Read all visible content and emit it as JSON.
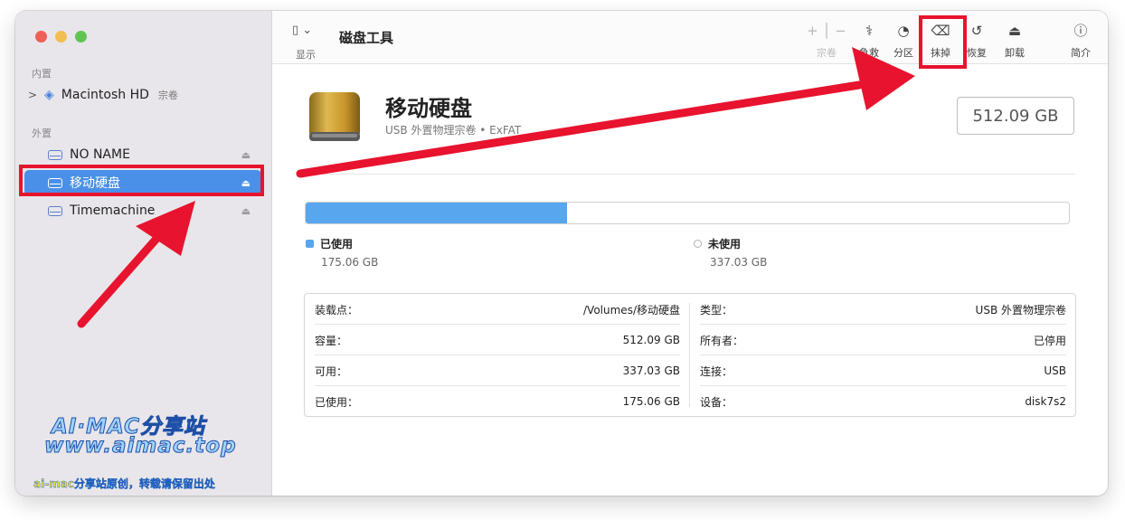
{
  "sidebar": {
    "section_internal": "内置",
    "internal_items": [
      {
        "label": "Macintosh HD",
        "sub": "宗卷"
      }
    ],
    "section_external": "外置",
    "external_items": [
      {
        "label": "NO NAME"
      },
      {
        "label": "移动硬盘"
      },
      {
        "label": "Timemachine"
      }
    ],
    "eject_glyph": "⏏"
  },
  "watermark": {
    "line1": "AI·MAC分享站",
    "line2": "www.aimac.top",
    "line3": "ai-mac分享站原创，转载请保留出处"
  },
  "toolbar": {
    "view_label": "显示",
    "title": "磁盘工具",
    "buttons": [
      {
        "icon": "+ | −",
        "label": "宗卷",
        "enabled": false
      },
      {
        "icon": "stethoscope",
        "label": "急救",
        "enabled": true
      },
      {
        "icon": "pie",
        "label": "分区",
        "enabled": true
      },
      {
        "icon": "eraser",
        "label": "抹掉",
        "enabled": true,
        "highlighted": true
      },
      {
        "icon": "restore",
        "label": "恢复",
        "enabled": true
      },
      {
        "icon": "unmount",
        "label": "卸载",
        "enabled": true
      },
      {
        "icon": "info",
        "label": "简介",
        "enabled": true
      }
    ]
  },
  "volume": {
    "name": "移动硬盘",
    "subtitle": "USB 外置物理宗卷 • ExFAT",
    "capacity": "512.09 GB"
  },
  "usage": {
    "used_fraction": 0.342,
    "used_label": "已使用",
    "used_value": "175.06 GB",
    "free_label": "未使用",
    "free_value": "337.03 GB",
    "used_color": "#58a6ee"
  },
  "info_left": [
    {
      "k": "装载点：",
      "v": "/Volumes/移动硬盘"
    },
    {
      "k": "容量：",
      "v": "512.09 GB"
    },
    {
      "k": "可用：",
      "v": "337.03 GB"
    },
    {
      "k": "已使用：",
      "v": "175.06 GB"
    }
  ],
  "info_right": [
    {
      "k": "类型：",
      "v": "USB 外置物理宗卷"
    },
    {
      "k": "所有者：",
      "v": "已停用"
    },
    {
      "k": "连接：",
      "v": "USB"
    },
    {
      "k": "设备：",
      "v": "disk7s2"
    }
  ],
  "annotation_color": "#e8132e"
}
